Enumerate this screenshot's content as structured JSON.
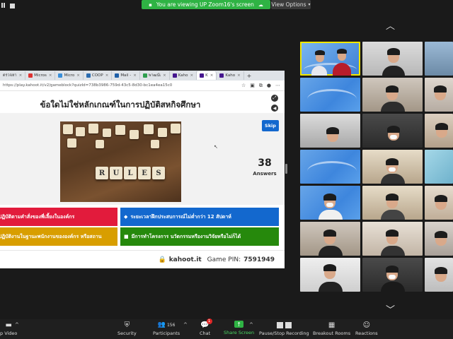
{
  "topbar": {
    "share_banner": "You are viewing UP Zoom16's screen",
    "view_options": "View Options"
  },
  "browser": {
    "tabs": [
      "ตรวจหา",
      "Micros",
      "Micro",
      "COOP",
      "Mail -",
      "พาฒน์เ",
      "Kaho",
      "K",
      "Kaho"
    ],
    "url": "https://play.kahoot.it/v2/gameblock?quizId=738b3986-759d-43c5-8d30-bc1ea4ea15c0"
  },
  "kahoot": {
    "question": "ข้อใดไม่ใช่หลักเกณฑ์ในการปฏิบัติสหกิจศึกษา",
    "skip_label": "Skip",
    "answers_count": "38",
    "answers_label": "Answers",
    "rules_word": [
      "R",
      "U",
      "L",
      "E",
      "S"
    ],
    "answers": [
      "ปฏิบัติตามคำสั่งของพี่เลี้ยงในองค์กร",
      "ระยะเวลาฝึกประสบการณ์ไม่ต่ำกว่า 12 สัปดาห์",
      "ปฏิบัติงานในฐานะพนักงานขององค์กร หรือสถาน",
      "มีการทำโครงการ นวัตกรรมหรืองานวิจัยหรือไม่ก็ได้"
    ],
    "footer_domain": "kahoot.it",
    "footer_pin_label": "Game PIN:",
    "footer_pin": "7591949"
  },
  "toolbar": {
    "video": "p Video",
    "security": "Security",
    "participants": "Participants",
    "participants_count": "156",
    "chat": "Chat",
    "chat_badge": "1",
    "share": "Share Screen",
    "record": "Pause/Stop Recording",
    "breakout": "Breakout Rooms",
    "reactions": "Reactions"
  },
  "colors": {
    "share_green": "#2fb344",
    "kahoot_red": "#e21b3c",
    "kahoot_blue": "#1368ce",
    "kahoot_yellow": "#d89e00",
    "kahoot_green": "#26890c"
  }
}
